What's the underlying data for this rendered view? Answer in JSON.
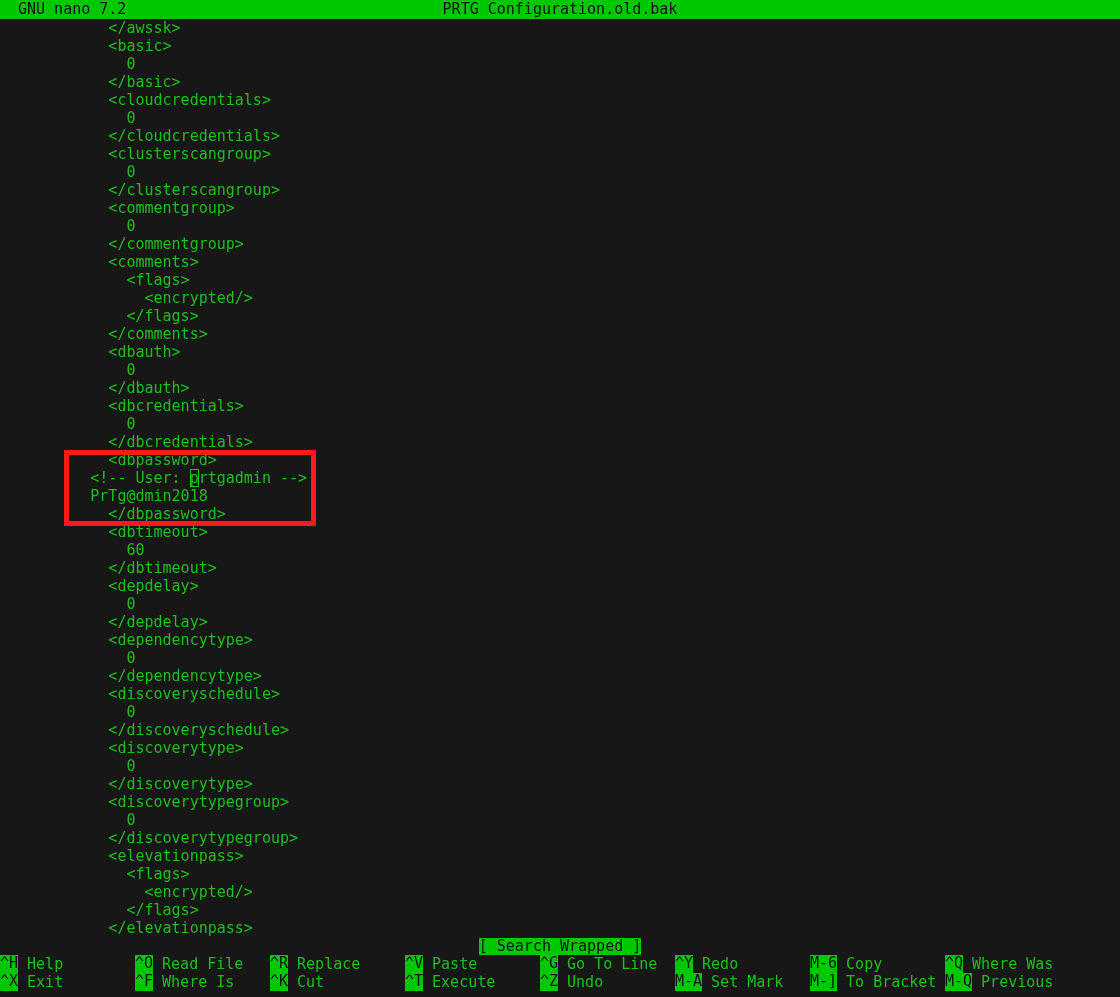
{
  "title_bar": {
    "app": "GNU nano 7.2",
    "file": "PRTG Configuration.old.bak"
  },
  "content": [
    {
      "kind": "line",
      "text": "            </awssk>"
    },
    {
      "kind": "line",
      "text": "            <basic>"
    },
    {
      "kind": "line",
      "text": "              0"
    },
    {
      "kind": "line",
      "text": "            </basic>"
    },
    {
      "kind": "line",
      "text": "            <cloudcredentials>"
    },
    {
      "kind": "line",
      "text": "              0"
    },
    {
      "kind": "line",
      "text": "            </cloudcredentials>"
    },
    {
      "kind": "line",
      "text": "            <clusterscangroup>"
    },
    {
      "kind": "line",
      "text": "              0"
    },
    {
      "kind": "line",
      "text": "            </clusterscangroup>"
    },
    {
      "kind": "line",
      "text": "            <commentgroup>"
    },
    {
      "kind": "line",
      "text": "              0"
    },
    {
      "kind": "line",
      "text": "            </commentgroup>"
    },
    {
      "kind": "line",
      "text": "            <comments>"
    },
    {
      "kind": "line",
      "text": "              <flags>"
    },
    {
      "kind": "line",
      "text": "                <encrypted/>"
    },
    {
      "kind": "line",
      "text": "              </flags>"
    },
    {
      "kind": "line",
      "text": "            </comments>"
    },
    {
      "kind": "line",
      "text": "            <dbauth>"
    },
    {
      "kind": "line",
      "text": "              0"
    },
    {
      "kind": "line",
      "text": "            </dbauth>"
    },
    {
      "kind": "line",
      "text": "            <dbcredentials>"
    },
    {
      "kind": "line",
      "text": "              0"
    },
    {
      "kind": "line",
      "text": "            </dbcredentials>"
    },
    {
      "kind": "highlight",
      "lines": [
        {
          "text": "            <dbpassword>"
        },
        {
          "text": "          <!-- User: ",
          "cursor": "p",
          "rest": "rtgadmin -->"
        },
        {
          "text": "          PrTg@dmin2018"
        },
        {
          "text": "            </dbpassword>"
        }
      ]
    },
    {
      "kind": "line",
      "text": "            <dbtimeout>"
    },
    {
      "kind": "line",
      "text": "              60"
    },
    {
      "kind": "line",
      "text": "            </dbtimeout>"
    },
    {
      "kind": "line",
      "text": "            <depdelay>"
    },
    {
      "kind": "line",
      "text": "              0"
    },
    {
      "kind": "line",
      "text": "            </depdelay>"
    },
    {
      "kind": "line",
      "text": "            <dependencytype>"
    },
    {
      "kind": "line",
      "text": "              0"
    },
    {
      "kind": "line",
      "text": "            </dependencytype>"
    },
    {
      "kind": "line",
      "text": "            <discoveryschedule>"
    },
    {
      "kind": "line",
      "text": "              0"
    },
    {
      "kind": "line",
      "text": "            </discoveryschedule>"
    },
    {
      "kind": "line",
      "text": "            <discoverytype>"
    },
    {
      "kind": "line",
      "text": "              0"
    },
    {
      "kind": "line",
      "text": "            </discoverytype>"
    },
    {
      "kind": "line",
      "text": "            <discoverytypegroup>"
    },
    {
      "kind": "line",
      "text": "              0"
    },
    {
      "kind": "line",
      "text": "            </discoverytypegroup>"
    },
    {
      "kind": "line",
      "text": "            <elevationpass>"
    },
    {
      "kind": "line",
      "text": "              <flags>"
    },
    {
      "kind": "line",
      "text": "                <encrypted/>"
    },
    {
      "kind": "line",
      "text": "              </flags>"
    },
    {
      "kind": "line",
      "text": "            </elevationpass>"
    }
  ],
  "status": "[ Search Wrapped ]",
  "shortcuts": [
    [
      {
        "key": "^H",
        "label": "Help"
      },
      {
        "key": "^O",
        "label": "Read File"
      },
      {
        "key": "^R",
        "label": "Replace"
      },
      {
        "key": "^V",
        "label": "Paste"
      },
      {
        "key": "^G",
        "label": "Go To Line"
      },
      {
        "key": "^Y",
        "label": "Redo"
      },
      {
        "key": "M-6",
        "label": "Copy"
      },
      {
        "key": "^Q",
        "label": "Where Was"
      }
    ],
    [
      {
        "key": "^X",
        "label": "Exit"
      },
      {
        "key": "^F",
        "label": "Where Is"
      },
      {
        "key": "^K",
        "label": "Cut"
      },
      {
        "key": "^T",
        "label": "Execute"
      },
      {
        "key": "^Z",
        "label": "Undo"
      },
      {
        "key": "M-A",
        "label": "Set Mark"
      },
      {
        "key": "M-]",
        "label": "To Bracket"
      },
      {
        "key": "M-Q",
        "label": "Previous"
      }
    ]
  ]
}
